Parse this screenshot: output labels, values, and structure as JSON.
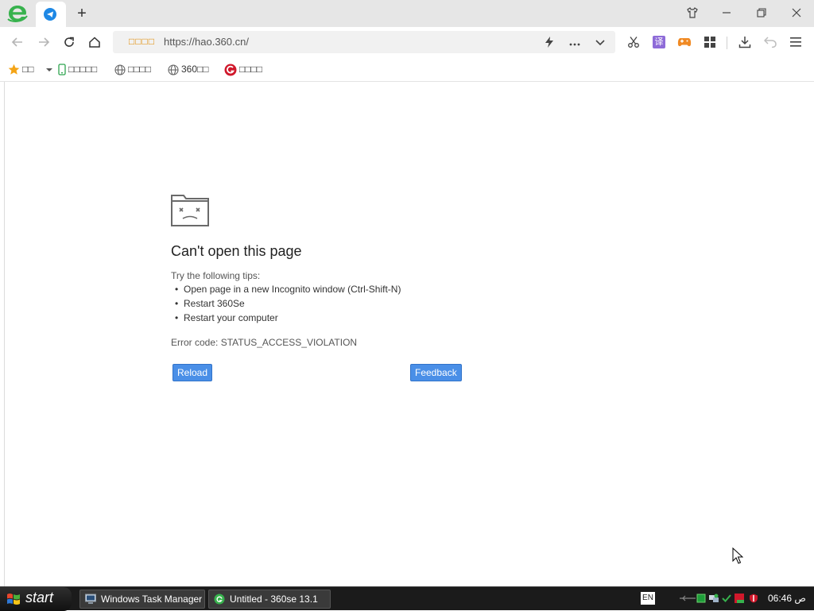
{
  "browser": {
    "address": {
      "prefix": "□□□□",
      "url": "https://hao.360.cn/"
    }
  },
  "bookmarks": [
    {
      "label": "□□",
      "icon": "star-icon"
    },
    {
      "label": "□□□□□",
      "icon": "phone-icon"
    },
    {
      "label": "□□□□",
      "icon": "globe-icon"
    },
    {
      "label": "360□□",
      "icon": "globe-icon"
    },
    {
      "label": "□□□□",
      "icon": "game-logo-icon"
    }
  ],
  "error_page": {
    "title": "Can't open this page",
    "tips_intro": "Try the following tips:",
    "tips": [
      "Open page in a new Incognito window (Ctrl-Shift-N)",
      "Restart 360Se",
      "Restart your computer"
    ],
    "error_code": "Error code: STATUS_ACCESS_VIOLATION",
    "reload_label": "Reload",
    "feedback_label": "Feedback"
  },
  "taskbar": {
    "start_label": "start",
    "tasks": [
      {
        "label": "Windows Task Manager",
        "icon": "task-manager-icon"
      },
      {
        "label": "Untitled - 360se 13.1",
        "icon": "browser-360-icon"
      }
    ],
    "tray_lang": "EN",
    "clock": "06:46 ص"
  },
  "colors": {
    "button_blue": "#4a8fe7",
    "taskbar_bg": "#1b1b1b",
    "tab_strip_bg": "#e6e6e6"
  }
}
